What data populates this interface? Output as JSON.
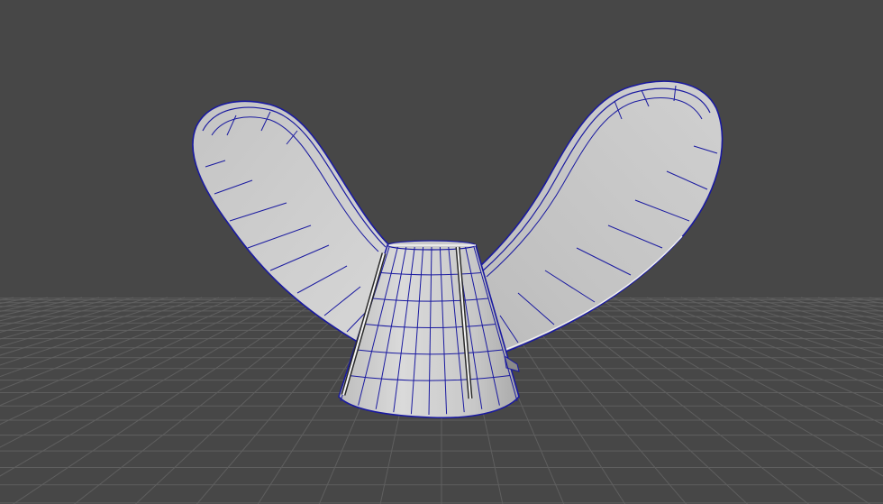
{
  "viewport": {
    "background_color": "#474747",
    "grid_color": "#5f5f5f",
    "grid_visible": true,
    "wireframe_color": "#1a1aa0",
    "mesh_fill_color": "#d2d2d2",
    "mesh_shade_color": "#9a9a9a",
    "selected_edge_color": "#f5f5f5",
    "object_icon": "wing-nut-mesh-icon"
  }
}
